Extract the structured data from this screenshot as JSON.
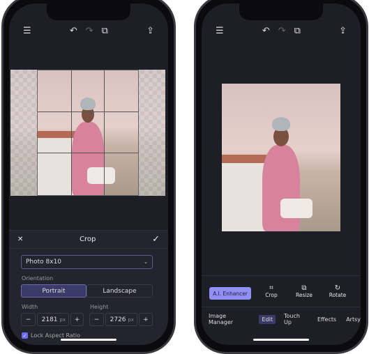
{
  "left": {
    "topbar": {
      "menu_icon": "☰",
      "undo_icon": "↶",
      "redo_icon": "↷",
      "crop_icon": "⧉",
      "share_icon": "⇪"
    },
    "crop": {
      "title": "Crop",
      "close_icon": "✕",
      "confirm_icon": "✓",
      "preset": "Photo 8x10",
      "orientation_label": "Orientation",
      "portrait": "Portrait",
      "landscape": "Landscape",
      "width_label": "Width",
      "width_value": "2181",
      "height_label": "Height",
      "height_value": "2726",
      "unit": "px",
      "minus": "−",
      "plus": "+",
      "lock_label": "Lock Aspect Ratio",
      "lock_checked": true
    }
  },
  "right": {
    "toolbar": {
      "ai": "A.I. Enhancer",
      "crop": "Crop",
      "resize": "Resize",
      "rotate": "Rotate"
    },
    "tabs": [
      "Image Manager",
      "Edit",
      "Touch Up",
      "Effects",
      "Artsy"
    ],
    "active_tab": "Edit",
    "accent": "#8f8ff5"
  }
}
